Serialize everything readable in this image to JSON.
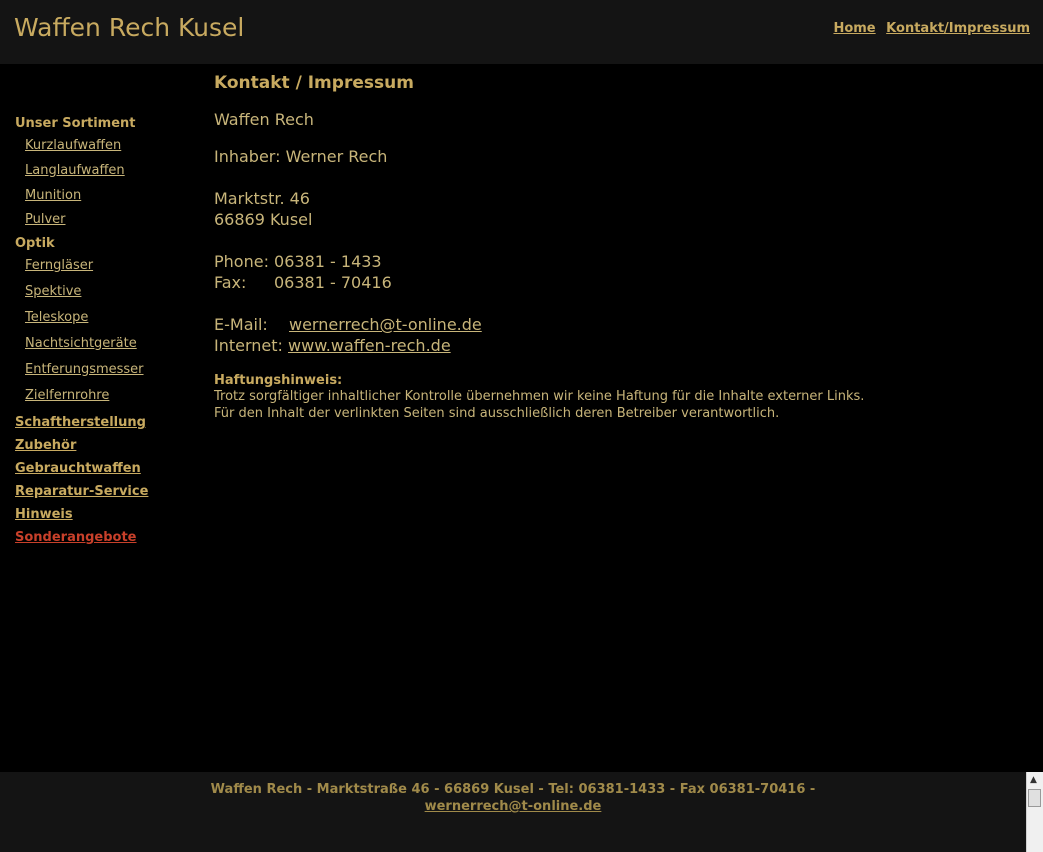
{
  "header": {
    "site_title": "Waffen Rech Kusel",
    "nav": {
      "home": "Home",
      "contact": "Kontakt/Impressum"
    }
  },
  "sidebar": {
    "heading_sortiment": "Unser Sortiment",
    "sortiment_items": [
      "Kurzlaufwaffen",
      "Langlaufwaffen",
      "Munition",
      "Pulver"
    ],
    "heading_optik": "Optik",
    "optik_items": [
      "Ferngläser",
      "Spektive",
      "Teleskope",
      "Nachtsichtgeräte",
      "Entferungsmesser",
      "Zielfernrohre"
    ],
    "main_items": [
      "Schaftherstellung",
      "Zubehör",
      "Gebrauchtwaffen",
      "Reparatur-Service",
      "Hinweis"
    ],
    "special_item": "Sonderangebote"
  },
  "main": {
    "heading": "Kontakt / Impressum",
    "company": "Waffen Rech",
    "owner": "Inhaber: Werner Rech",
    "street": "Marktstr. 46",
    "city": "66869 Kusel",
    "phone_label": "Phone:",
    "phone_value": "06381 - 1433",
    "fax_label": "Fax:",
    "fax_value": "06381 - 70416",
    "email_label": "E-Mail:",
    "email_value": "wernerrech@t-online.de",
    "internet_label": "Internet:",
    "internet_value": "www.waffen-rech.de",
    "disclaimer_title": "Haftungshinweis:",
    "disclaimer_line1": "Trotz sorgfältiger inhaltlicher Kontrolle übernehmen wir keine Haftung für die Inhalte externer Links.",
    "disclaimer_line2": "Für den Inhalt der verlinkten Seiten sind ausschließlich deren Betreiber verantwortlich."
  },
  "footer": {
    "text": "Waffen Rech - Marktstraße 46  - 66869 Kusel - Tel: 06381-1433 - Fax 06381-70416 -",
    "email": "wernerrech@t-online.de"
  },
  "colors": {
    "gold": "#c8aa60",
    "special_red": "#c8402a",
    "background": "#000000",
    "bar": "#141414"
  }
}
